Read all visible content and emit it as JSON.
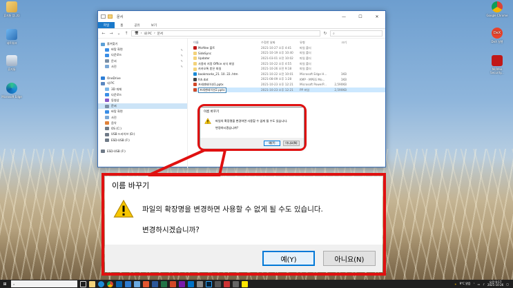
{
  "desktop_left": [
    {
      "label": "휴지통 입니다"
    },
    {
      "label": "네트워크"
    },
    {
      "label": "휴지통"
    },
    {
      "label": "Microsoft Edge"
    }
  ],
  "desktop_right": [
    {
      "label": "Google Chrome"
    },
    {
      "label": "DeX 실행"
    },
    {
      "label": "McAfee Security..."
    }
  ],
  "explorer": {
    "title": "문서",
    "ribbon_tabs": [
      "파일",
      "홈",
      "공유",
      "보기"
    ],
    "path": [
      "내 PC",
      "문서"
    ],
    "search_placeholder": "",
    "sidebar": [
      {
        "label": "즐겨찾기",
        "pinned": false
      },
      {
        "label": "바탕 화면",
        "pinned": true
      },
      {
        "label": "다운로드",
        "pinned": true
      },
      {
        "label": "문서",
        "pinned": true
      },
      {
        "label": "사진",
        "pinned": true
      },
      {
        "label": "",
        "pinned": false
      },
      {
        "label": "OneDrive",
        "pinned": false
      },
      {
        "label": "내 PC",
        "pinned": false
      },
      {
        "label": "3D 개체",
        "pinned": false
      },
      {
        "label": "다운로드",
        "pinned": false
      },
      {
        "label": "동영상",
        "pinned": false
      },
      {
        "label": "문서",
        "pinned": false
      },
      {
        "label": "바탕 화면",
        "pinned": false
      },
      {
        "label": "사진",
        "pinned": false
      },
      {
        "label": "음악",
        "pinned": false
      },
      {
        "label": "OS (C:)",
        "pinned": false
      },
      {
        "label": "USB 드라이브 (D:)",
        "pinned": false
      },
      {
        "label": "ESD-USB (F:)",
        "pinned": false
      },
      {
        "label": "",
        "pinned": false
      },
      {
        "label": "ESD-USB (F:)",
        "pinned": false
      }
    ],
    "columns": {
      "name": "이름",
      "date": "수정한 날짜",
      "type": "유형",
      "size": "크기"
    },
    "files": [
      {
        "name": "McAfee 볼트",
        "date": "2021-10-27 오후 4:41",
        "type": "파일 폴더",
        "size": ""
      },
      {
        "name": "SideSync",
        "date": "2021-10-19 오후 10:40",
        "type": "파일 폴더",
        "size": ""
      },
      {
        "name": "Updater",
        "date": "2021-03-01 오전 10:02",
        "type": "파일 폴더",
        "size": ""
      },
      {
        "name": "사용자 지정 Office 서식 파일",
        "date": "2021-10-22 오후 4:55",
        "type": "파일 폴더",
        "size": ""
      },
      {
        "name": "카카오톡 받은 파일",
        "date": "2021-10-26 오전 9:18",
        "type": "파일 폴더",
        "size": ""
      },
      {
        "name": "bookmarks_21. 10. 22..htm",
        "date": "2021-10-22 오전 10:01",
        "type": "Microsoft Edge H...",
        "size": "1KB"
      },
      {
        "name": "fsh.dat",
        "date": "2021-08-09 오후 1:28",
        "type": "KMP - MPEG Mo...",
        "size": "1KB"
      },
      {
        "name": "프레젠테이션1.pptx",
        "date": "2021-10-23 오후 12:21",
        "type": "Microsoft PowerP...",
        "size": "2,590KB"
      },
      {
        "name": "프레젠테이션2.pptx",
        "date": "2021-10-23 오후 12:21",
        "type": "PP 파일",
        "size": "2,590KB"
      }
    ]
  },
  "dialog": {
    "title": "이름 바꾸기",
    "message": "파일의 확장명을 변경하면 사용할 수 없게 될 수도 있습니다.",
    "question": "변경하시겠습니까?",
    "yes": "예(Y)",
    "no": "아니요(N)"
  },
  "taskbar": {
    "search_placeholder": "",
    "weather": "9°C 맑음",
    "time": "오전 9:17",
    "date": "2021-10-26"
  },
  "colors": {
    "accent": "#1979ca",
    "callout": "#e01010",
    "default_button": "#0078d7"
  }
}
